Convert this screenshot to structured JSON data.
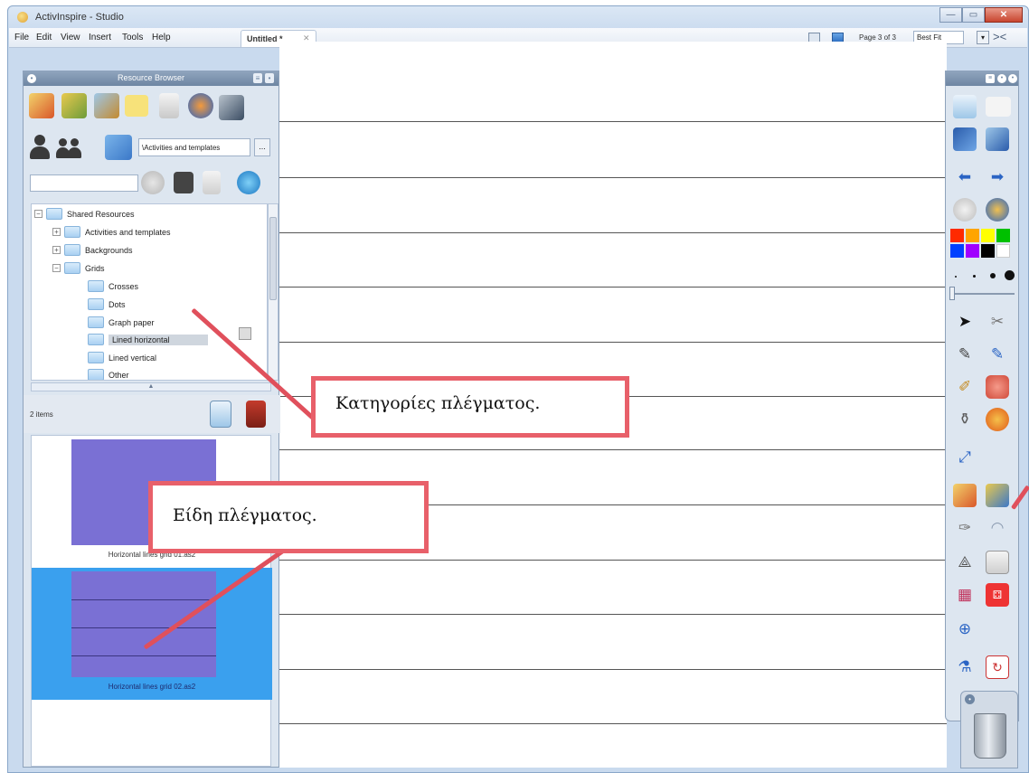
{
  "window": {
    "title": "ActivInspire - Studio",
    "buttons": [
      "—",
      "▭",
      "✕"
    ]
  },
  "menubar": {
    "items": [
      "File",
      "Edit",
      "View",
      "Insert",
      "Tools",
      "Help"
    ],
    "document_tab": "Untitled *",
    "page_info": "Page 3 of 3",
    "zoom": "Best Fit"
  },
  "resource_browser": {
    "title": "Resource Browser",
    "path": "\\Activities and templates",
    "path_button": "...",
    "tree": [
      {
        "label": "Shared Resources",
        "expander": "−"
      },
      {
        "label": "Activities and templates",
        "expander": "+"
      },
      {
        "label": "Backgrounds",
        "expander": "+"
      },
      {
        "label": "Grids",
        "expander": "−"
      },
      {
        "label": "Crosses"
      },
      {
        "label": "Dots"
      },
      {
        "label": "Graph paper"
      },
      {
        "label": "Lined horizontal"
      },
      {
        "label": "Lined vertical"
      },
      {
        "label": "Other"
      }
    ],
    "items_count": "2 items",
    "items": [
      {
        "caption": "Horizontal lines grid 01.as2",
        "selected": false
      },
      {
        "caption": "Horizontal lines grid 02.as2",
        "selected": true
      }
    ]
  },
  "toolbox": {
    "colors": [
      "#ff2a00",
      "#ffa500",
      "#ffff00",
      "#00c000",
      "#0040ff",
      "#a000ff",
      "#000000",
      "#ffffff"
    ]
  },
  "annotations": {
    "categories": "Κατηγορίες πλέγματος.",
    "types": "Είδη πλέγματος."
  },
  "accent_color": "#e8606a",
  "selection_color": "#3aa0ee"
}
